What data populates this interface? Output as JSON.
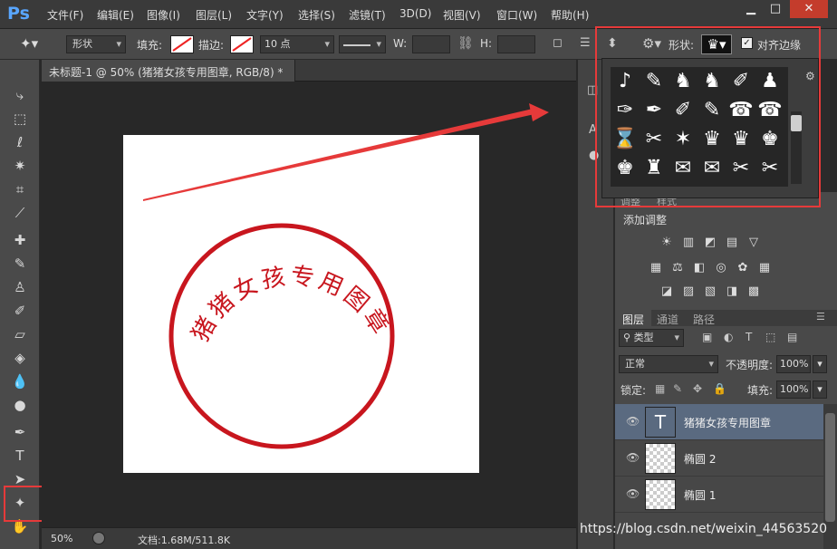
{
  "app": {
    "logo": "Ps"
  },
  "menubar": {
    "items": [
      "文件(F)",
      "编辑(E)",
      "图像(I)",
      "图层(L)",
      "文字(Y)",
      "选择(S)",
      "滤镜(T)",
      "3D(D)",
      "视图(V)",
      "窗口(W)",
      "帮助(H)"
    ],
    "window_controls": [
      "▁",
      "□",
      "✕"
    ]
  },
  "options": {
    "mode_value": "形状",
    "fill_label": "填充:",
    "stroke_label": "描边:",
    "stroke_size": "10 点",
    "w_label": "W:",
    "h_label": "H:",
    "shape_label": "形状:",
    "align_edges_label": "对齐边缘",
    "align_edges_checked": true
  },
  "document": {
    "tab_title": "未标题-1 @ 50% (猪猪女孩专用图章, RGB/8) *",
    "stamp_text": "猪猪女孩专用图章",
    "stamp_color": "#c8161e"
  },
  "status": {
    "zoom": "50%",
    "doc_size": "文档:1.68M/511.8K"
  },
  "shape_picker": {
    "shapes": [
      "♪",
      "✎",
      "♞",
      "♞",
      "✐",
      "♟",
      "✑",
      "✒",
      "✐",
      "✎",
      "☎",
      "☎",
      "⌛",
      "✂",
      "✶",
      "♛",
      "♛",
      "♚",
      "♚",
      "♜",
      "✉",
      "✉",
      "✂",
      "✂",
      "✂",
      "▦",
      "▦"
    ]
  },
  "adjustments": {
    "tab_labels": [
      "调整",
      "样式"
    ],
    "title": "添加调整",
    "icons_row1": [
      "☀",
      "▥",
      "◩",
      "▤",
      "▽"
    ],
    "icons_row2": [
      "▦",
      "⚖",
      "◧",
      "◎",
      "✿",
      "▦"
    ],
    "icons_row3": [
      "◪",
      "▨",
      "▧",
      "◨",
      "▩"
    ]
  },
  "layers": {
    "tabs": [
      "图层",
      "通道",
      "路径"
    ],
    "filter_value": "类型",
    "blend_mode": "正常",
    "opacity_label": "不透明度:",
    "opacity_value": "100%",
    "lock_label": "锁定:",
    "fill_label": "填充:",
    "fill_value": "100%",
    "list": [
      {
        "name": "猪猪女孩专用图章",
        "kind": "text",
        "selected": true
      },
      {
        "name": "椭圆 2",
        "kind": "shape",
        "selected": false
      },
      {
        "name": "椭圆 1",
        "kind": "shape",
        "selected": false
      }
    ]
  },
  "watermark": "https://blog.csdn.net/weixin_44563520"
}
